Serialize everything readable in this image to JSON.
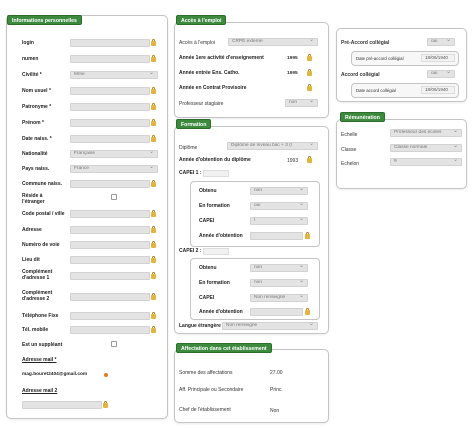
{
  "perso": {
    "title": "Informations personnelles",
    "login": "login",
    "numen": "numen",
    "civilite": "Civilité *",
    "civilite_val": "Mme",
    "nom_usuel": "Nom usuel *",
    "patronyme": "Patronyme *",
    "prenom": "Prénom *",
    "date_naiss": "Date naiss. *",
    "nationalite": "Nationalité",
    "nationalite_val": "Française",
    "pays_naiss": "Pays naiss.",
    "pays_val": "France",
    "commune": "Commune naiss.",
    "reside": "Réside à l'étranger",
    "code_postal": "Code postal / ville",
    "adresse": "Adresse",
    "numero_voie": "Numéro de voie",
    "lieu_dit": "Lieu dit",
    "complement1": "Complément d'adresse 1",
    "complement2": "Complément d'adresse 2",
    "tel_fixe": "Téléphone Fixe",
    "tel_mobile": "Tél. mobile",
    "suppleant": "Est un suppléant",
    "adresse_mail": "Adresse mail *",
    "email_val": "mag.bouret2404@gmail.com",
    "adresse_mail2": "Adresse mail 2"
  },
  "emploi": {
    "title": "Accès à l'emploi",
    "acces": "Accès à l'emploi",
    "acces_val": "CRPE externe",
    "annee_ens": "Année 1ere activité d'enseignement",
    "annee_ens_val": "1995",
    "annee_catho": "Année entrée Ens. Catho.",
    "annee_catho_val": "1995",
    "annee_contrat": "Année en Contrat Provisoire",
    "stagiaire": "Professeur stagiaire",
    "stagiaire_val": "non"
  },
  "formation": {
    "title": "Formation",
    "diplome": "Diplôme",
    "diplome_val": "Diplôme de niveau bac + 3 (l",
    "annee_diplome": "Année d'obtention du diplôme",
    "annee_diplome_val": "1993",
    "capei1": "CAPEI 1 :",
    "capei2": "CAPEI 2 :",
    "obtenu": "Obtenu",
    "en_formation": "En formation",
    "capei": "CAPEI",
    "annee_obtention": "Année d'obtention",
    "c1_obtenu_val": "non",
    "c1_formation_val": "oui",
    "c1_capei_val": "I",
    "c2_obtenu_val": "non",
    "c2_formation_val": "non",
    "c2_capei_val": "Non renseigné",
    "langue": "Langue étrangère",
    "langue_val": "Non renseigné"
  },
  "affectation": {
    "title": "Affectation dans cet établissement",
    "somme": "Somme des affectations",
    "somme_val": "27.00",
    "aff_principale": "Aff. Principale ou Secondaire",
    "aff_val": "Princ.",
    "chef": "Chef de l'établissement",
    "chef_val": "Non"
  },
  "accord": {
    "pre_accord": "Pré-Accord collégial",
    "pre_accord_val": "oui",
    "date_pre": "Date pré-accord collégial",
    "date_pre_val": "18/06/1940",
    "accord": "Accord collégial",
    "accord_val": "oui",
    "date_accord": "Date accord collégial",
    "date_accord_val": "18/06/1940"
  },
  "remuneration": {
    "title": "Rémunération",
    "echelle": "Echelle",
    "echelle_val": "Professeur des écoles",
    "classe": "Classe",
    "classe_val": "Classe normale",
    "echelon": "Echelon",
    "echelon_val": "9"
  }
}
